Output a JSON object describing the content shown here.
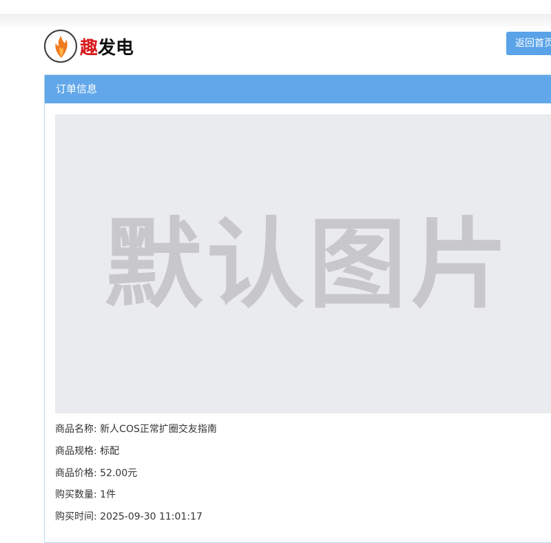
{
  "header": {
    "logo_accent": "趣",
    "logo_rest": "发电",
    "home_button": "返回首页"
  },
  "panel": {
    "title": "订单信息",
    "image_placeholder": "默认图片"
  },
  "order": {
    "name_label": "商品名称:",
    "name_value": "新人COS正常扩圈交友指南",
    "spec_label": "商品规格:",
    "spec_value": "标配",
    "price_label": "商品价格:",
    "price_value": "52.00元",
    "qty_label": "购买数量:",
    "qty_value": "1件",
    "time_label": "购买时间:",
    "time_value": "2025-09-30 11:01:17"
  },
  "colors": {
    "primary": "#62a7e9",
    "button": "#5aa3e8",
    "logo_accent": "#d7191c"
  }
}
